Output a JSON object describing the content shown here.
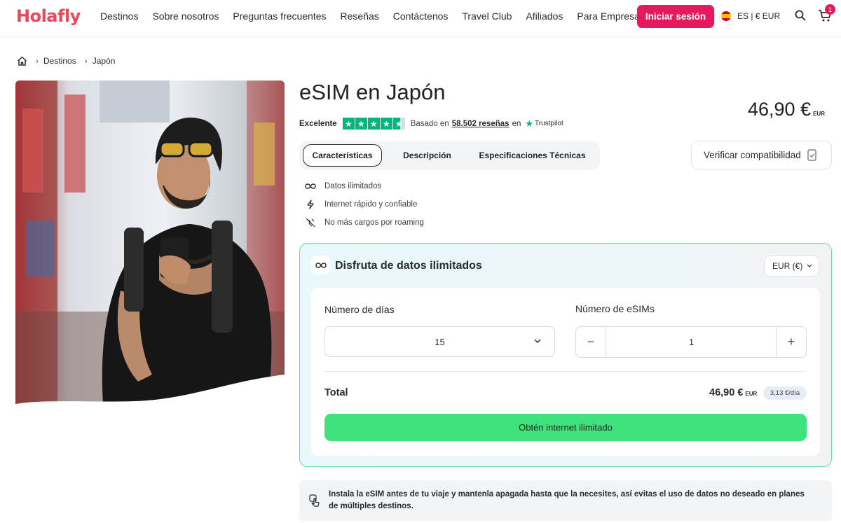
{
  "header": {
    "logo": "Holafly",
    "nav": [
      "Destinos",
      "Sobre nosotros",
      "Preguntas frecuentes",
      "Reseñas",
      "Contáctenos",
      "Travel Club",
      "Afiliados",
      "Para Empresas"
    ],
    "login_label": "Iniciar sesión",
    "locale": "ES | € EUR",
    "cart_count": "1"
  },
  "breadcrumb": [
    "Destinos",
    "Japón"
  ],
  "product": {
    "title": "eSIM en Japón",
    "price": "46,90 €",
    "currency_code": "EUR",
    "rating_label": "Excelente",
    "rating_stars": 4.5,
    "based_on": "Basado en",
    "review_count": "58.502 reseñas",
    "on": "en",
    "trustpilot": "Trustpilot"
  },
  "tabs": [
    "Características",
    "Descripción",
    "Especificaciones Técnicas"
  ],
  "verify_label": "Verificar compatibilidad",
  "features": [
    "Datos ilimitados",
    "Internet rápido y confiable",
    "No más cargos por roaming"
  ],
  "plan": {
    "title": "Disfruta de datos ilimitados",
    "currency_select": "EUR (€)",
    "days_label": "Número de días",
    "days_value": "15",
    "esims_label": "Número de eSIMs",
    "esims_value": "1",
    "total_label": "Total",
    "total_value": "46,90 €",
    "total_currency": "EUR",
    "per_day": "3,13 €/día",
    "cta": "Obtén internet ilimitado"
  },
  "notice": "Instala la eSIM antes de tu viaje y mantenla apagada hasta que la necesites, así evitas el uso de datos no deseado en planes de múltiples destinos.",
  "colors": {
    "brand": "#e6185e",
    "cta": "#40e27c",
    "star": "#00b67a"
  }
}
